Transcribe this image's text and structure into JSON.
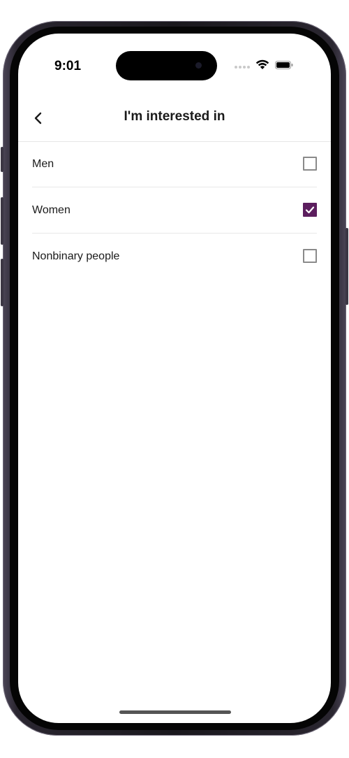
{
  "status_bar": {
    "time": "9:01"
  },
  "header": {
    "title": "I'm interested in",
    "back_icon": "chevron-left-icon"
  },
  "options": [
    {
      "label": "Men",
      "checked": false
    },
    {
      "label": "Women",
      "checked": true
    },
    {
      "label": "Nonbinary people",
      "checked": false
    }
  ],
  "colors": {
    "accent": "#5c1e5e",
    "divider": "#e8e8e8"
  }
}
